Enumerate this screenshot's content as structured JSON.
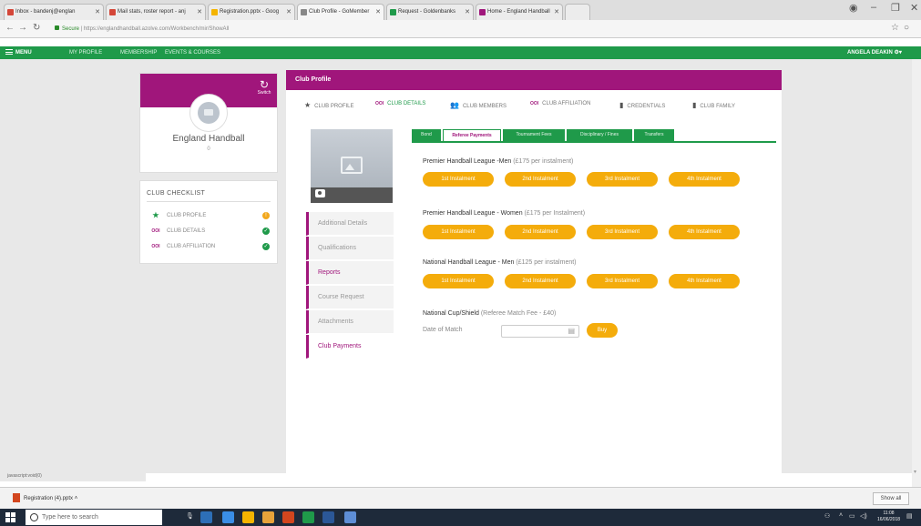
{
  "browser": {
    "tabs": [
      {
        "label": "Inbox - bandenj@englan",
        "color": "#d44638"
      },
      {
        "label": "Mail stats, roster report - anj",
        "color": "#d44638"
      },
      {
        "label": "Registration.pptx - Goog",
        "color": "#f4b400"
      },
      {
        "label": "Club Profile - GoMember",
        "color": "#888888",
        "active": true
      },
      {
        "label": "Request - Goldenbanks",
        "color": "#1f9a4a"
      },
      {
        "label": "Home - England Handball",
        "color": "#a0167b"
      }
    ],
    "url_secure": "Secure",
    "url": "https://englandhandball.azolve.com/Workbench/mir/ShowAll"
  },
  "appnav": {
    "menu": "MENU",
    "items": [
      "MY PROFILE",
      "MEMBERSHIP",
      "EVENTS & COURSES"
    ],
    "user": "ANGELA DEAKIN"
  },
  "profile": {
    "switch_label": "Switch",
    "club_name": "England Handball",
    "count": "0"
  },
  "checklist": {
    "title": "CLUB CHECKLIST",
    "items": [
      {
        "label": "CLUB PROFILE",
        "icon": "star-icon",
        "status": "warning"
      },
      {
        "label": "CLUB DETAILS",
        "icon": "ooo-icon",
        "status": "complete"
      },
      {
        "label": "CLUB AFFILIATION",
        "icon": "ooo-icon",
        "status": "complete"
      }
    ]
  },
  "main": {
    "header": "Club Profile",
    "tabs": [
      "CLUB PROFILE",
      "CLUB DETAILS",
      "CLUB MEMBERS",
      "CLUB AFFILIATION",
      "CREDENTIALS",
      "CLUB FAMILY"
    ],
    "active_tab": "CLUB DETAILS",
    "sidenav": [
      "Additional Details",
      "Qualifications",
      "Reports",
      "Course Request",
      "Attachments",
      "Club Payments"
    ],
    "subtabs": [
      "Bond",
      "Referee Payments",
      "Tournament Fees",
      "Disciplinary / Fines",
      "Transfers"
    ],
    "active_subtab": "Referee Payments",
    "leagues": [
      {
        "name": "Premier Handball League -Men",
        "note": "(£175 per instalment)"
      },
      {
        "name": "Premier Handball League - Women",
        "note": "(£175 per Instalment)"
      },
      {
        "name": "National Handball League - Men",
        "note": "(£125 per instalment)"
      }
    ],
    "installments": [
      "1st Instalment",
      "2nd Instalment",
      "3rd Instalment",
      "4th Instalment"
    ],
    "cup": {
      "name": "National Cup/Shield",
      "note": "(Referee Match Fee - £40)"
    },
    "date_label": "Date of Match",
    "buy_label": "Buy"
  },
  "status_text": "javascript:void(0)",
  "download": {
    "file": "Registration (4).pptx",
    "show_all": "Show all"
  },
  "taskbar": {
    "search_placeholder": "Type here to search",
    "time": "11:08",
    "date": "16/06/2018"
  }
}
